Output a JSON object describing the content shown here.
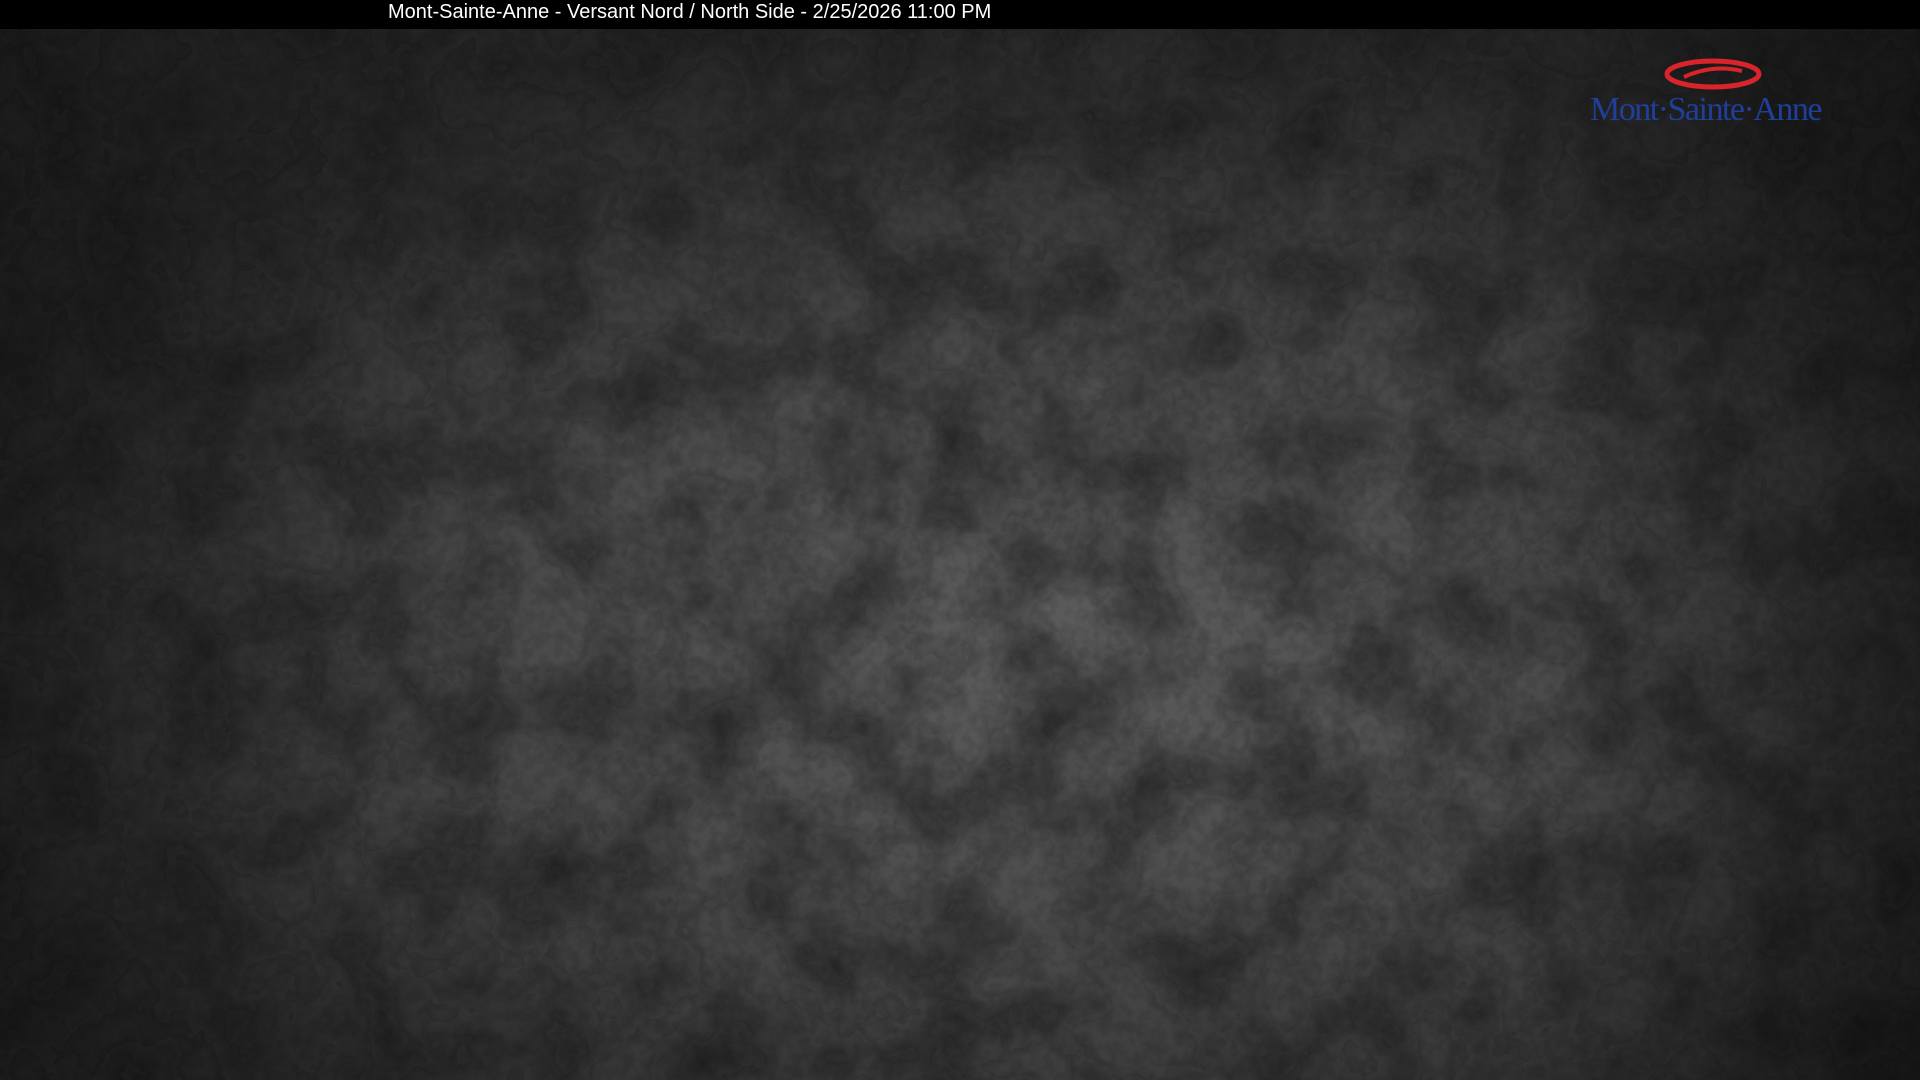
{
  "caption": {
    "text": "Mont-Sainte-Anne - Versant Nord / North Side - 2/25/2026 11:00 PM"
  },
  "logo": {
    "text": "Mont·Sainte·Anne",
    "text_color": "#1f3f9a",
    "ring_color": "#d9242b"
  },
  "scene": {
    "description_colors": {
      "base": "#2b2b2b",
      "fog": "#5a5a5a",
      "dark": "#1e1e1e"
    }
  }
}
